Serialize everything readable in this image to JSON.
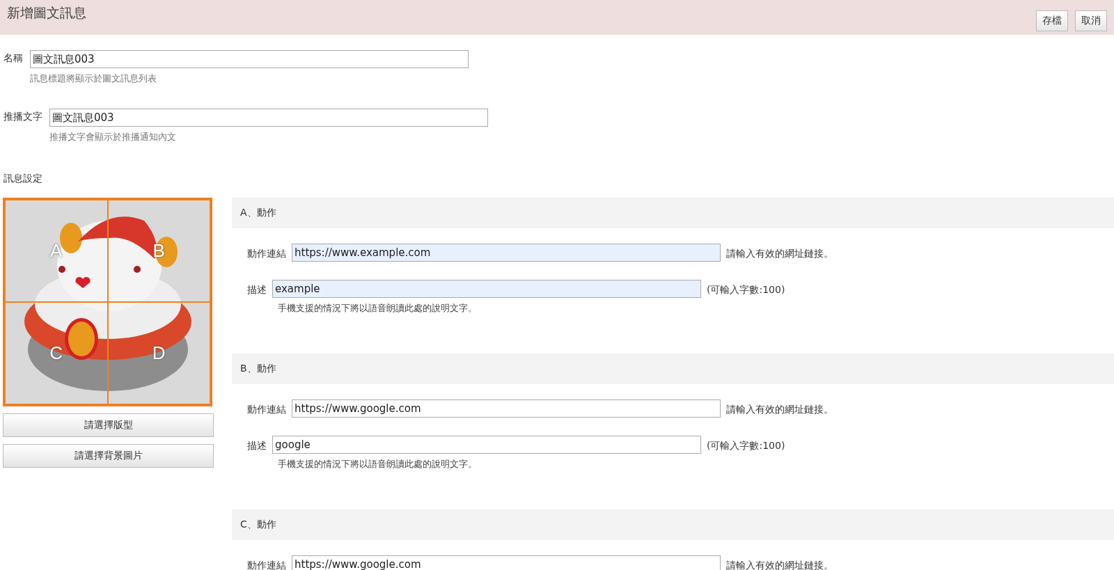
{
  "header": {
    "title": "新增圖文訊息",
    "buttons": [
      "存檔",
      "取消"
    ]
  },
  "fields": [
    {
      "label": "名稱",
      "value": "圖文訊息003",
      "hint": "訊息標題將顯示於圖文訊息列表"
    },
    {
      "label": "推播文字",
      "value": "圖文訊息003",
      "hint": "推播文字會顯示於推播通知內文"
    }
  ],
  "settings_title": "訊息設定",
  "image": {
    "zones": [
      "A",
      "B",
      "C",
      "D"
    ]
  },
  "image_buttons": [
    "請選擇版型",
    "請選擇背景圖片"
  ],
  "sections": [
    {
      "title": "A、動作",
      "autofilled": true,
      "link_label": "動作連結",
      "link_value": "https://www.example.com",
      "link_hint": "請輸入有效的網址鏈接。",
      "desc_label": "描述",
      "desc_value": "example",
      "desc_limit": "(可輸入字數:100)",
      "desc_note": "手機支援的情況下將以語音朗讀此處的說明文字。"
    },
    {
      "title": "B、動作",
      "autofilled": false,
      "link_label": "動作連結",
      "link_value": "https://www.google.com",
      "link_hint": "請輸入有效的網址鏈接。",
      "desc_label": "描述",
      "desc_value": "google",
      "desc_limit": "(可輸入字數:100)",
      "desc_note": "手機支援的情況下將以語音朗讀此處的說明文字。"
    },
    {
      "title": "C、動作",
      "autofilled": false,
      "link_label": "動作連結",
      "link_value": "https://www.google.com",
      "link_hint": "請輸入有效的網址鏈接。"
    }
  ]
}
